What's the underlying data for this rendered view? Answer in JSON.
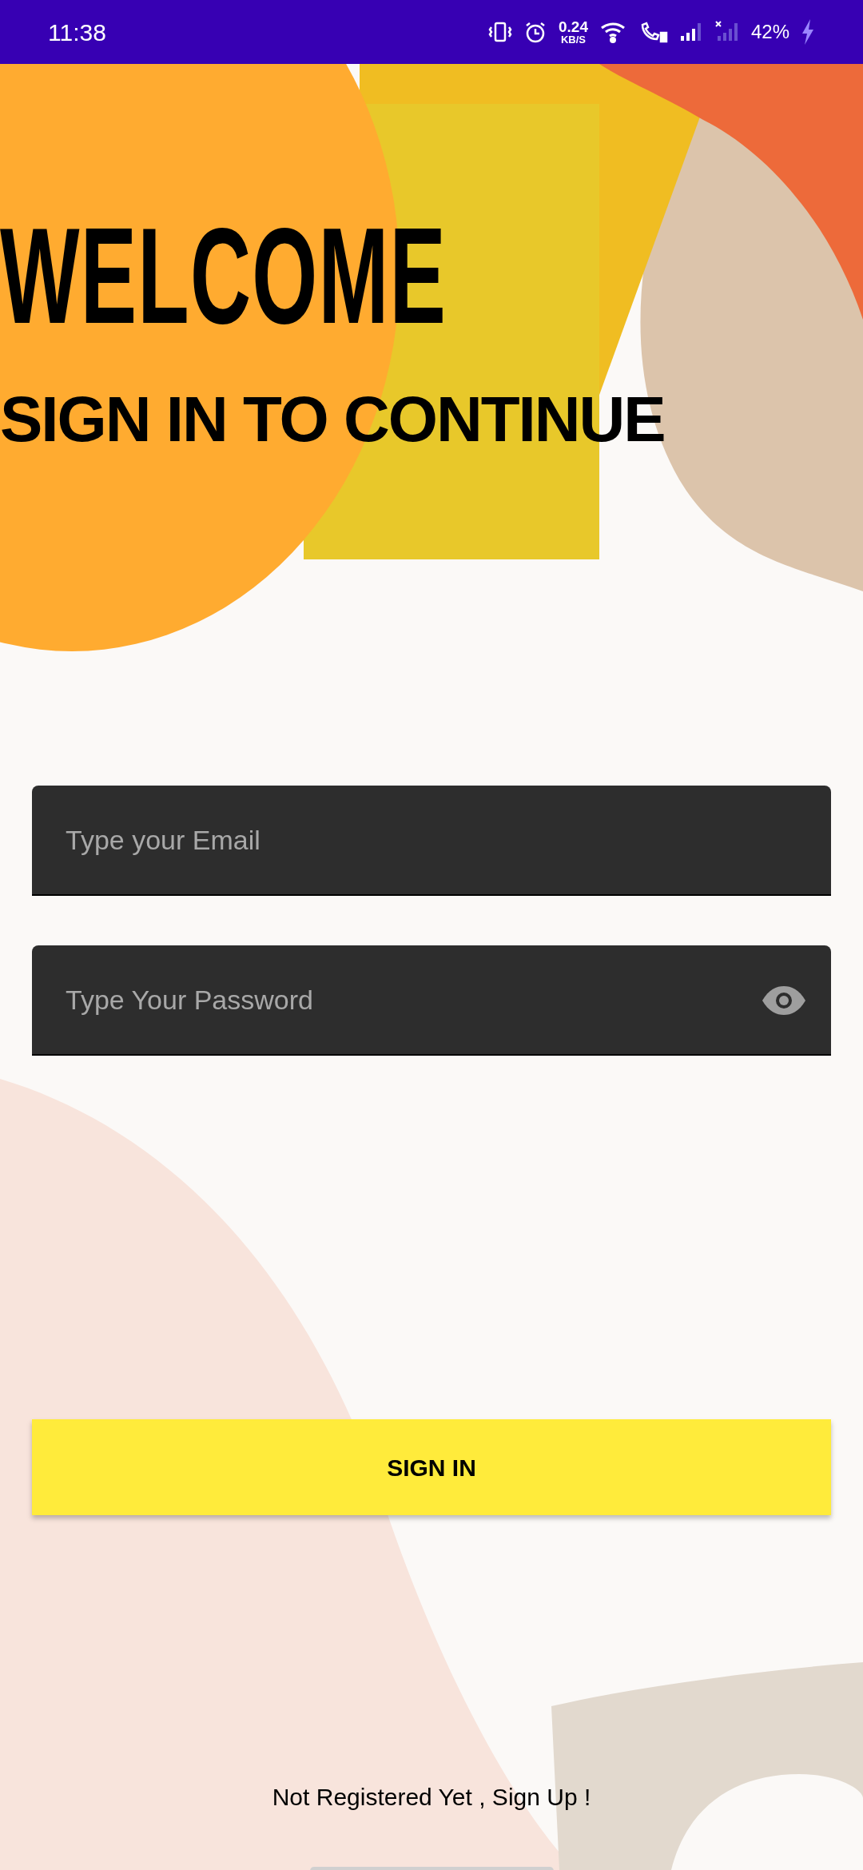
{
  "status_bar": {
    "time": "11:38",
    "speed_value": "0.24",
    "speed_unit": "KB/S",
    "battery": "42%"
  },
  "heading": {
    "title": "WELCOME",
    "subtitle": "SIGN IN TO CONTINUE"
  },
  "form": {
    "email": {
      "placeholder": "Type your Email"
    },
    "password": {
      "placeholder": "Type Your Password"
    }
  },
  "sign_in_button": "SIGN IN",
  "footer_link": "Not Registered Yet , Sign Up !"
}
